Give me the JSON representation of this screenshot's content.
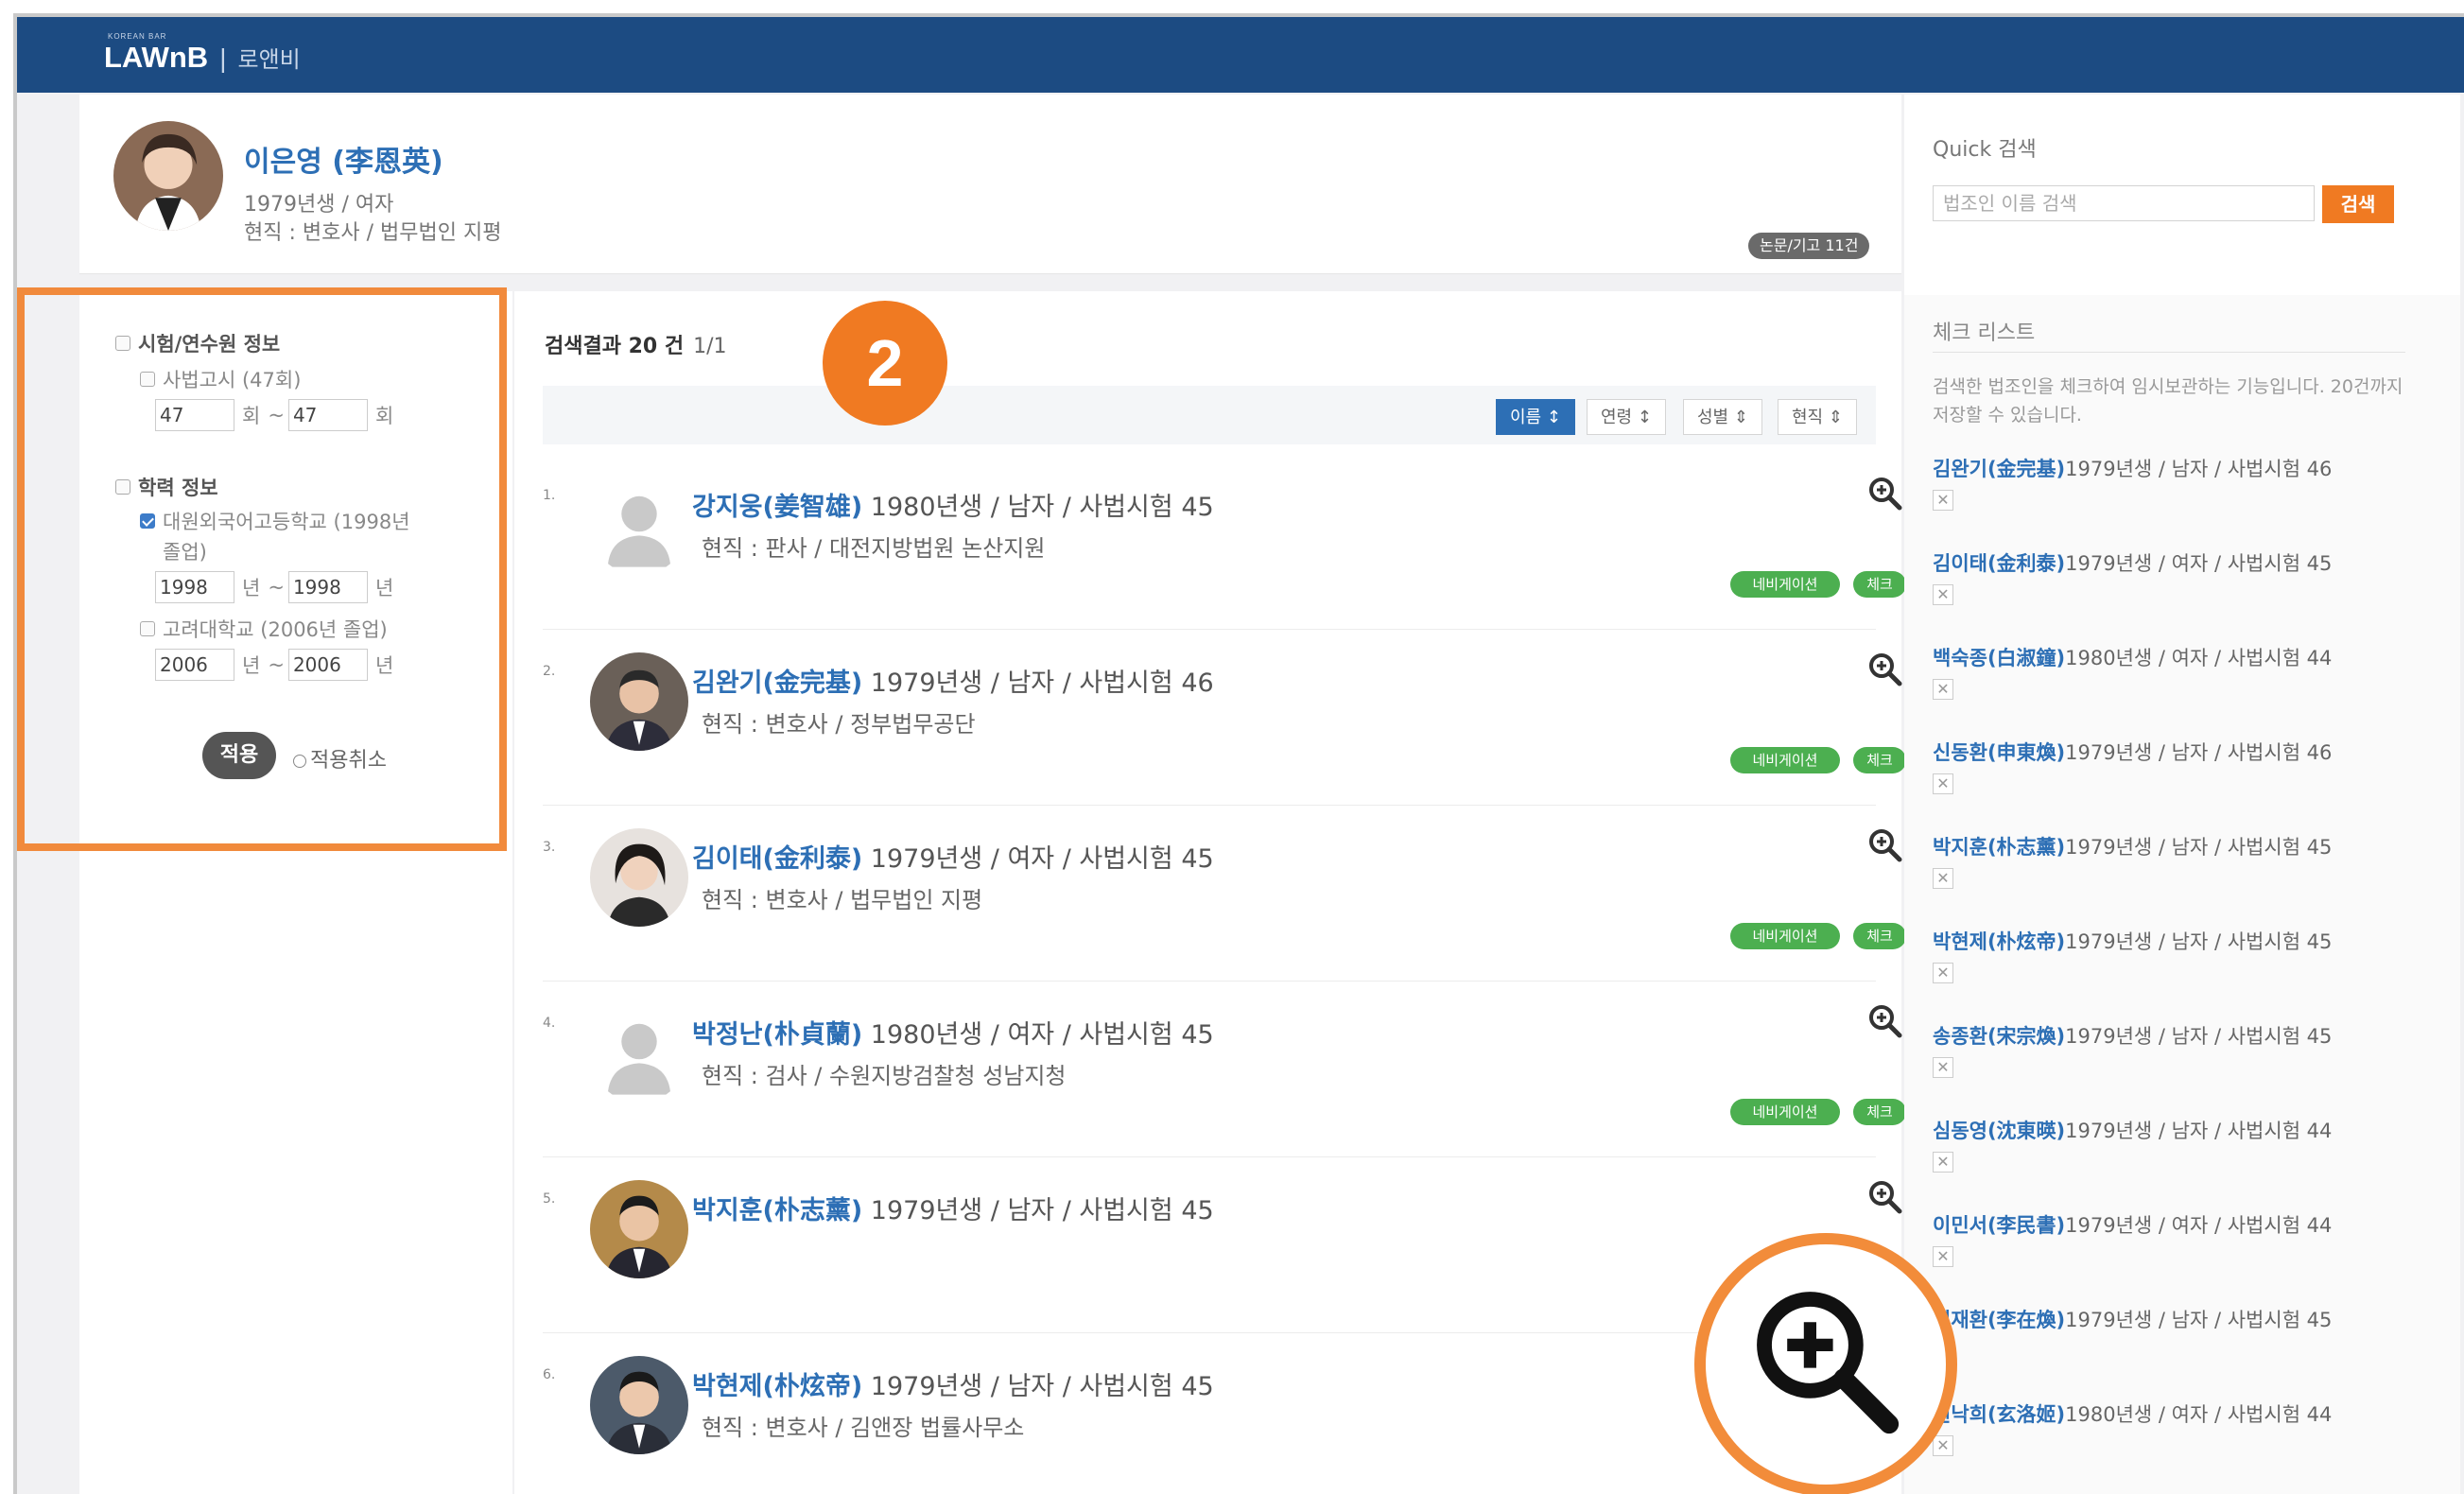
{
  "header": {
    "tiny": "KOREAN BAR",
    "brand": "LAWnB",
    "sep": "|",
    "ko": "로앤비"
  },
  "profile": {
    "name": "이은영 (李恩英)",
    "birth": "1979년생 / 여자",
    "job": "현직 : 변호사 / 법무법인 지평",
    "tag": "논문/기고 11건"
  },
  "filter": {
    "sec1": "시험/연수원 정보",
    "sec1_item": "사법고시 (47회)",
    "sec1_from": "47",
    "sec1_to": "47",
    "unit_hoe": "회",
    "dash": "~",
    "sec2": "학력 정보",
    "sec2_item1": "대원외국어고등학교 (1998년",
    "sec2_item1b": "졸업)",
    "sec2_from1": "1998",
    "sec2_to1": "1998",
    "unit_year": "년",
    "sec2_item2": "고려대학교 (2006년 졸업)",
    "sec2_from2": "2006",
    "sec2_to2": "2006",
    "apply": "적용",
    "cancel": "적용취소"
  },
  "results": {
    "count_label": "검색결과 20 건",
    "page": "1/1",
    "badge": "2",
    "sort": [
      "이름 ↕",
      "연령 ↕",
      "성별 ⇕",
      "현직 ⇕"
    ],
    "nav_label": "네비게이션",
    "check_label": "체크",
    "items": [
      {
        "idx": "1.",
        "name": "강지웅(姜智雄)",
        "info": " 1980년생 / 남자 / 사법시험 45",
        "job": "현직 : 판사 / 대전지방법원 논산지원"
      },
      {
        "idx": "2.",
        "name": "김완기(金完基)",
        "info": " 1979년생 / 남자 / 사법시험 46",
        "job": "현직 : 변호사 / 정부법무공단"
      },
      {
        "idx": "3.",
        "name": "김이태(金利泰)",
        "info": " 1979년생 / 여자 / 사법시험 45",
        "job": "현직 : 변호사 / 법무법인 지평"
      },
      {
        "idx": "4.",
        "name": "박정난(朴貞蘭)",
        "info": " 1980년생 / 여자 / 사법시험 45",
        "job": "현직 : 검사 / 수원지방검찰청 성남지청"
      },
      {
        "idx": "5.",
        "name": "박지훈(朴志薰)",
        "info": " 1979년생 / 남자 / 사법시험 45",
        "job": ""
      },
      {
        "idx": "6.",
        "name": "박현제(朴炫帝)",
        "info": " 1979년생 / 남자 / 사법시험 45",
        "job": "현직 : 변호사 / 김앤장 법률사무소"
      }
    ]
  },
  "quick": {
    "label": "Quick 검색",
    "placeholder": "법조인 이름 검색",
    "button": "검색"
  },
  "checklist": {
    "title": "체크 리스트",
    "desc": "검색한 법조인을 체크하여 임시보관하는 기능입니다. 20건까지 저장할 수 있습니다.",
    "remove": "✕",
    "items": [
      {
        "name": "김완기(金完基)",
        "info": "1979년생 / 남자 / 사법시험 46"
      },
      {
        "name": "김이태(金利泰)",
        "info": "1979년생 / 여자 / 사법시험 45"
      },
      {
        "name": "백숙종(白淑鐘)",
        "info": "1980년생 / 여자 / 사법시험 44"
      },
      {
        "name": "신동환(申東煥)",
        "info": "1979년생 / 남자 / 사법시험 46"
      },
      {
        "name": "박지훈(朴志薰)",
        "info": "1979년생 / 남자 / 사법시험 45"
      },
      {
        "name": "박현제(朴炫帝)",
        "info": "1979년생 / 남자 / 사법시험 45"
      },
      {
        "name": "송종환(宋宗煥)",
        "info": "1979년생 / 남자 / 사법시험 45"
      },
      {
        "name": "심동영(沈東暎)",
        "info": "1979년생 / 남자 / 사법시험 44"
      },
      {
        "name": "이민서(李民書)",
        "info": "1979년생 / 여자 / 사법시험 44"
      },
      {
        "name": "이재환(李在煥)",
        "info": "1979년생 / 남자 / 사법시험 45"
      },
      {
        "name": "현낙희(玄洛姬)",
        "info": "1980년생 / 여자 / 사법시험 44"
      }
    ]
  },
  "colors": {
    "header": "#1c4b82",
    "accent": "#f07a22",
    "link": "#2d6fb5",
    "pill": "#4caf50"
  }
}
